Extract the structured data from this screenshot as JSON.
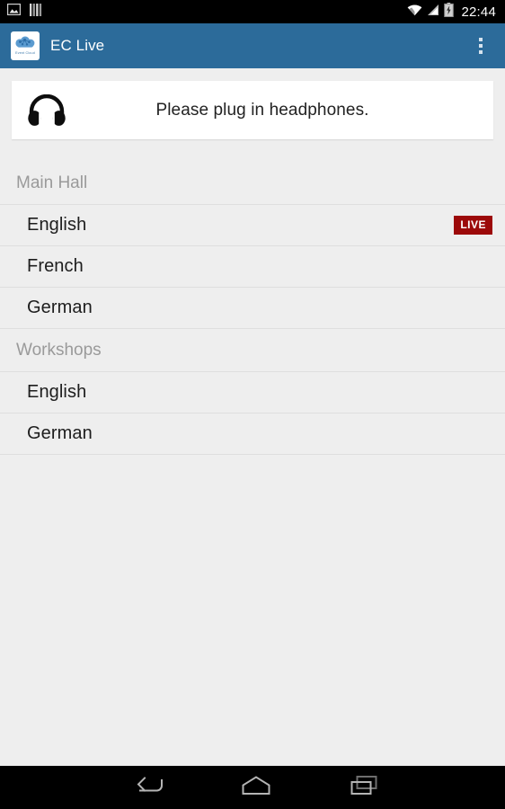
{
  "status_bar": {
    "icons_left": [
      "screenshot-icon",
      "equalizer-icon"
    ],
    "icons_right": [
      "wifi-icon",
      "cellular-signal-icon",
      "battery-charging-icon"
    ],
    "clock": "22:44"
  },
  "action_bar": {
    "logo_alt": "event-cloud-logo",
    "logo_caption": "Event Cloud",
    "title": "EC Live",
    "overflow_label": "overflow-menu-icon"
  },
  "notice": {
    "icon": "headphones-icon",
    "text": "Please plug in headphones."
  },
  "list": {
    "sections": [
      {
        "header": "Main Hall",
        "rows": [
          {
            "label": "English",
            "badge": "LIVE"
          },
          {
            "label": "French",
            "badge": ""
          },
          {
            "label": "German",
            "badge": ""
          }
        ]
      },
      {
        "header": "Workshops",
        "rows": [
          {
            "label": "English",
            "badge": ""
          },
          {
            "label": "German",
            "badge": ""
          }
        ]
      }
    ]
  },
  "nav_bar": {
    "back": "back-icon",
    "home": "home-icon",
    "recents": "recents-icon"
  },
  "colors": {
    "accent": "#2c6b9a",
    "background": "#eeeeee",
    "card": "#ffffff",
    "live_badge": "#9c0909",
    "divider": "#dedede",
    "section_header_text": "#9a9a9a",
    "row_text": "#1d1d1d"
  }
}
